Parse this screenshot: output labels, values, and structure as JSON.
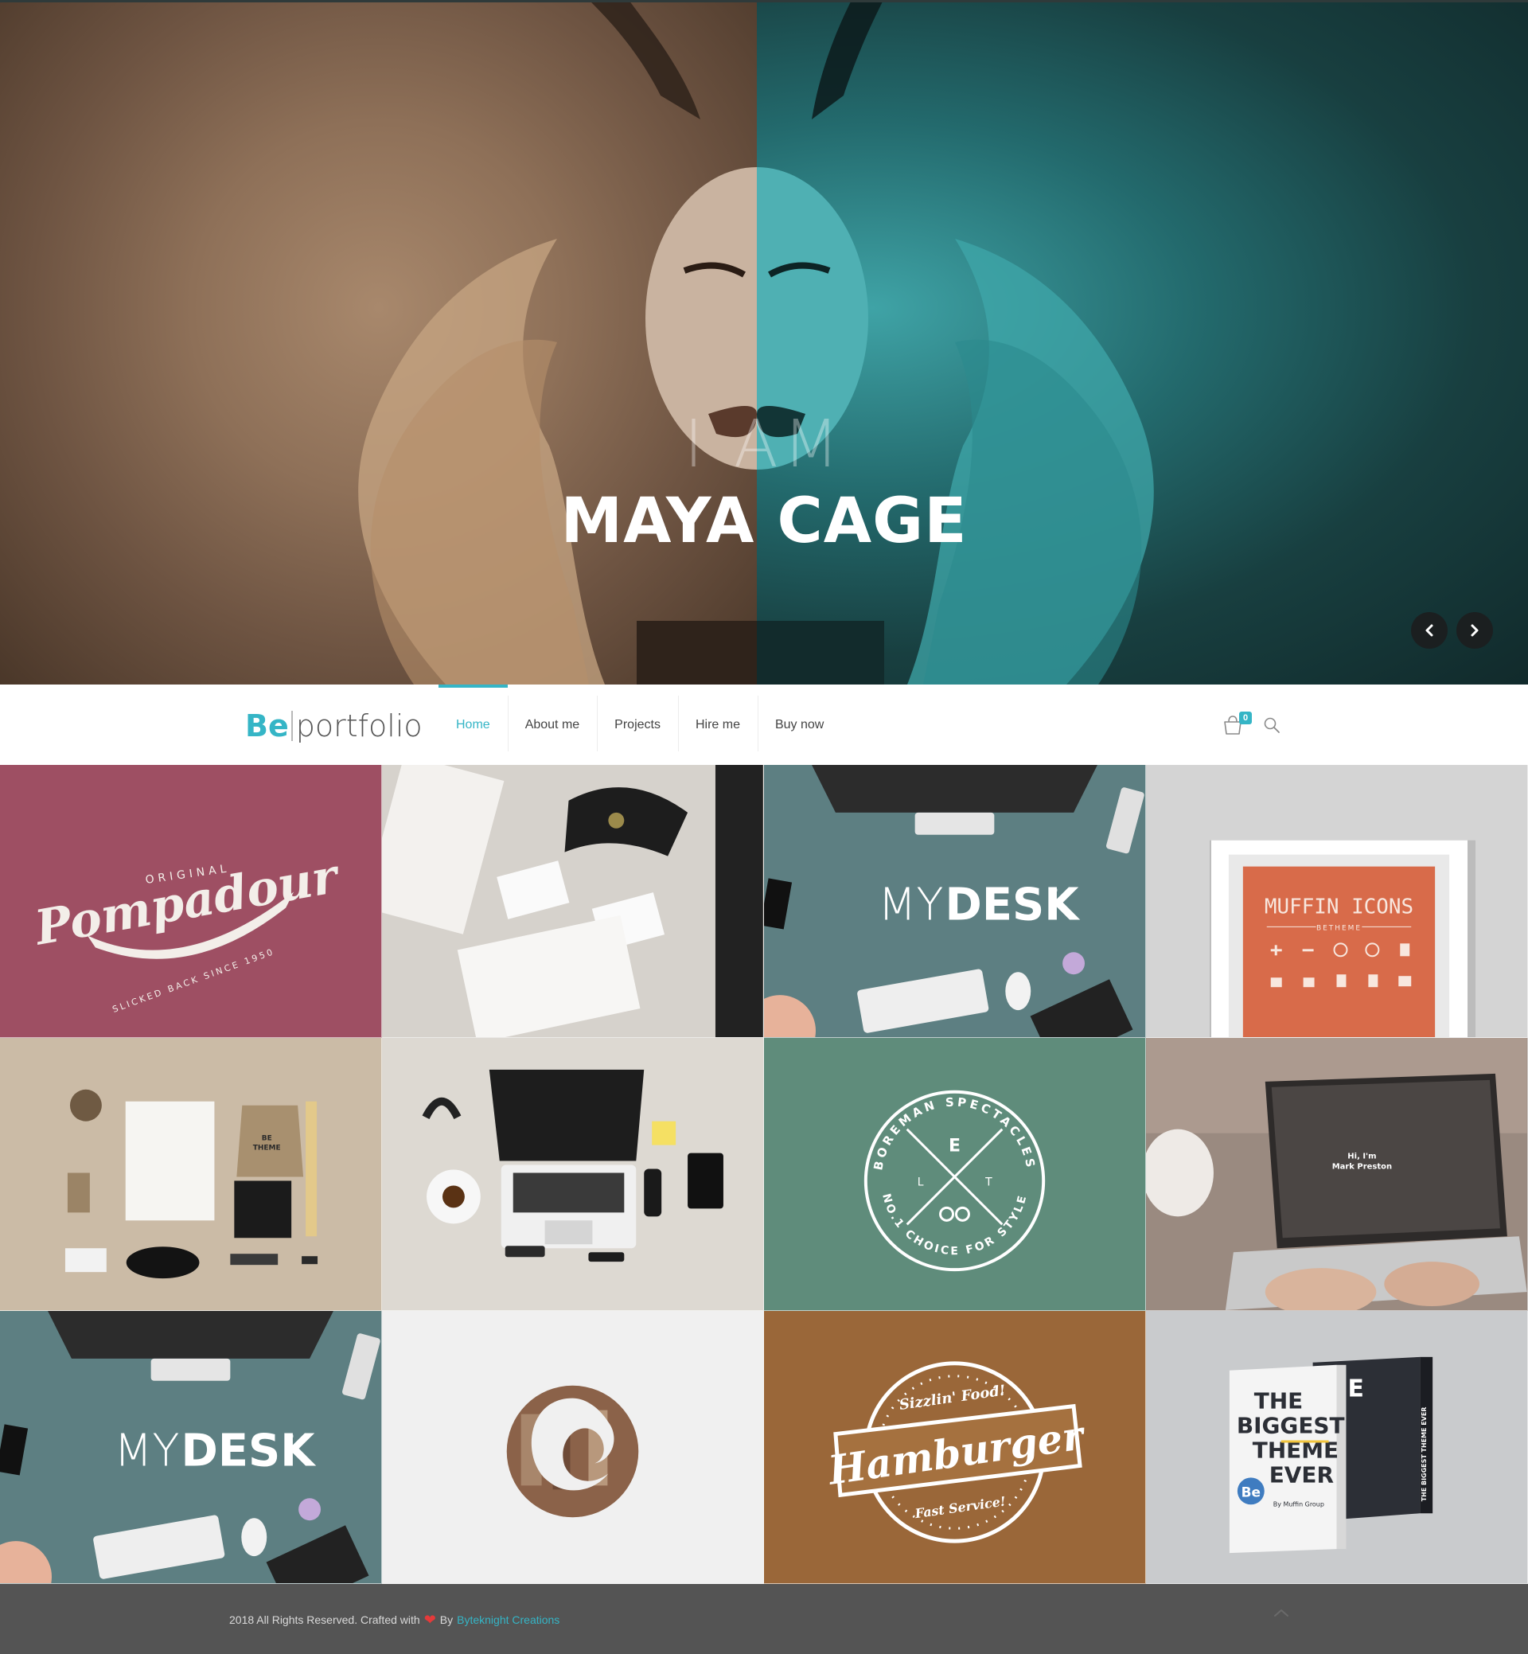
{
  "hero": {
    "intro": "I AM",
    "name": "MAYA CAGE",
    "prev_icon": "chevron-left-icon",
    "next_icon": "chevron-right-icon",
    "colors": {
      "left_tone": "#8e7058",
      "right_tone": "#2a8285"
    }
  },
  "header": {
    "logo": {
      "mark": "Be",
      "word": "portfolio"
    },
    "nav": [
      {
        "label": "Home",
        "active": true
      },
      {
        "label": "About me",
        "active": false
      },
      {
        "label": "Projects",
        "active": false
      },
      {
        "label": "Hire me",
        "active": false
      },
      {
        "label": "Buy now",
        "active": false
      }
    ],
    "cart_count": "0",
    "cart_icon": "shopping-bag-icon",
    "search_icon": "search-icon"
  },
  "portfolio": {
    "items": [
      {
        "title": "Pompadour",
        "lines": [
          "ORIGINAL",
          "Pompadour",
          "SLICKED BACK SINCE 1950"
        ],
        "bg": "#9e4f63"
      },
      {
        "title": "Stationery mockup",
        "bg": "#cfcac3"
      },
      {
        "title": "MYDESK",
        "brand": [
          "MY",
          "DESK",
          "™"
        ],
        "bg": "#5d7f82"
      },
      {
        "title": "Muffin Icons",
        "lines": [
          "MUFFIN ICONS",
          "BETHEME"
        ],
        "bg": "#d4d4d4"
      },
      {
        "title": "Branding set",
        "lines": [
          "BE",
          "THEME"
        ],
        "bg": "#cbbba6"
      },
      {
        "title": "Workspace",
        "bg": "#ddd9d2"
      },
      {
        "title": "Boreman Spectacles",
        "lines": [
          "BOREMAN SPECTACLES",
          "E",
          "L",
          "T",
          "NO.1 CHOICE FOR STYLE"
        ],
        "bg": "#5f8c7b"
      },
      {
        "title": "Laptop",
        "lines": [
          "Hi, I'm",
          "Mark Preston"
        ],
        "bg": "#8a7d75"
      },
      {
        "title": "MYDESK",
        "brand": [
          "MY",
          "DESK",
          "™"
        ],
        "bg": "#5d7f82"
      },
      {
        "title": "Circle logo",
        "bg": "#f0f0f0"
      },
      {
        "title": "Hamburger",
        "lines": [
          "Sizzlin' Food!",
          "Hamburger",
          "Fast Service!"
        ],
        "bg": "#a5713f"
      },
      {
        "title": "The Biggest Theme Ever",
        "lines": [
          "THE",
          "BIGGEST",
          "THEME",
          "EVER",
          "Be",
          "By Muffin Group",
          "THE BIGGEST THEME EVER"
        ],
        "bg": "#c9cbcd"
      }
    ]
  },
  "footer": {
    "text": "2018 All Rights Reserved. Crafted with",
    "by": "By",
    "author": "Byteknight Creations",
    "heart_icon": "heart-icon",
    "back_to_top_icon": "chevron-up-icon"
  }
}
